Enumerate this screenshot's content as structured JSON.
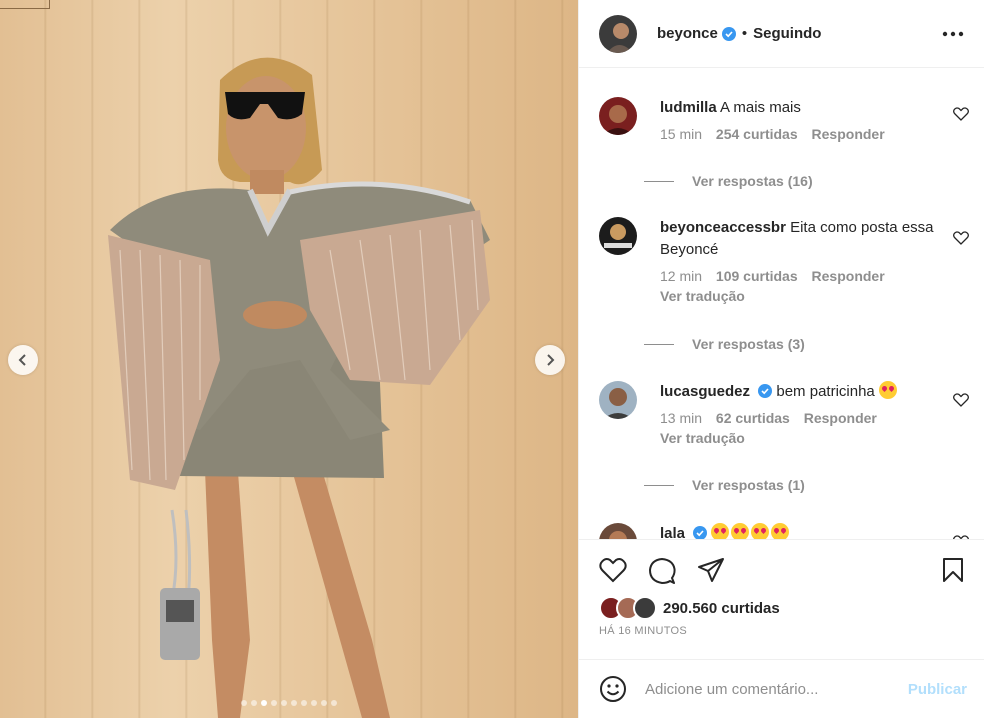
{
  "header": {
    "username": "beyonce",
    "separator": "•",
    "follow_status": "Seguindo"
  },
  "comments": [
    {
      "user": "ludmilla",
      "text": "A mais mais",
      "time": "15 min",
      "likes": "254 curtidas",
      "reply": "Responder",
      "replies": "Ver respostas (16)"
    },
    {
      "user": "beyonceaccessbr",
      "text": "Eita como posta essa Beyoncé",
      "time": "12 min",
      "likes": "109 curtidas",
      "reply": "Responder",
      "translate": "Ver tradução",
      "replies": "Ver respostas (3)"
    },
    {
      "user": "lucasguedez",
      "text": "bem patricinha",
      "time": "13 min",
      "likes": "62 curtidas",
      "reply": "Responder",
      "translate": "Ver tradução",
      "replies": "Ver respostas (1)"
    },
    {
      "user": "lala",
      "emoji_count": 4
    }
  ],
  "likes": "290.560 curtidas",
  "timestamp": "HÁ 16 MINUTOS",
  "add_comment": {
    "placeholder": "Adicione um comentário...",
    "publish": "Publicar"
  },
  "carousel": {
    "total": 10,
    "active_index": 2
  },
  "colors": {
    "verified": "#3897f0",
    "link_disabled": "#b2dffc",
    "muted": "#8e8e8e"
  },
  "icons": [
    "heart-icon",
    "comment-icon",
    "share-icon",
    "bookmark-icon",
    "more-icon",
    "smile-icon",
    "chevron-left-icon",
    "chevron-right-icon"
  ]
}
